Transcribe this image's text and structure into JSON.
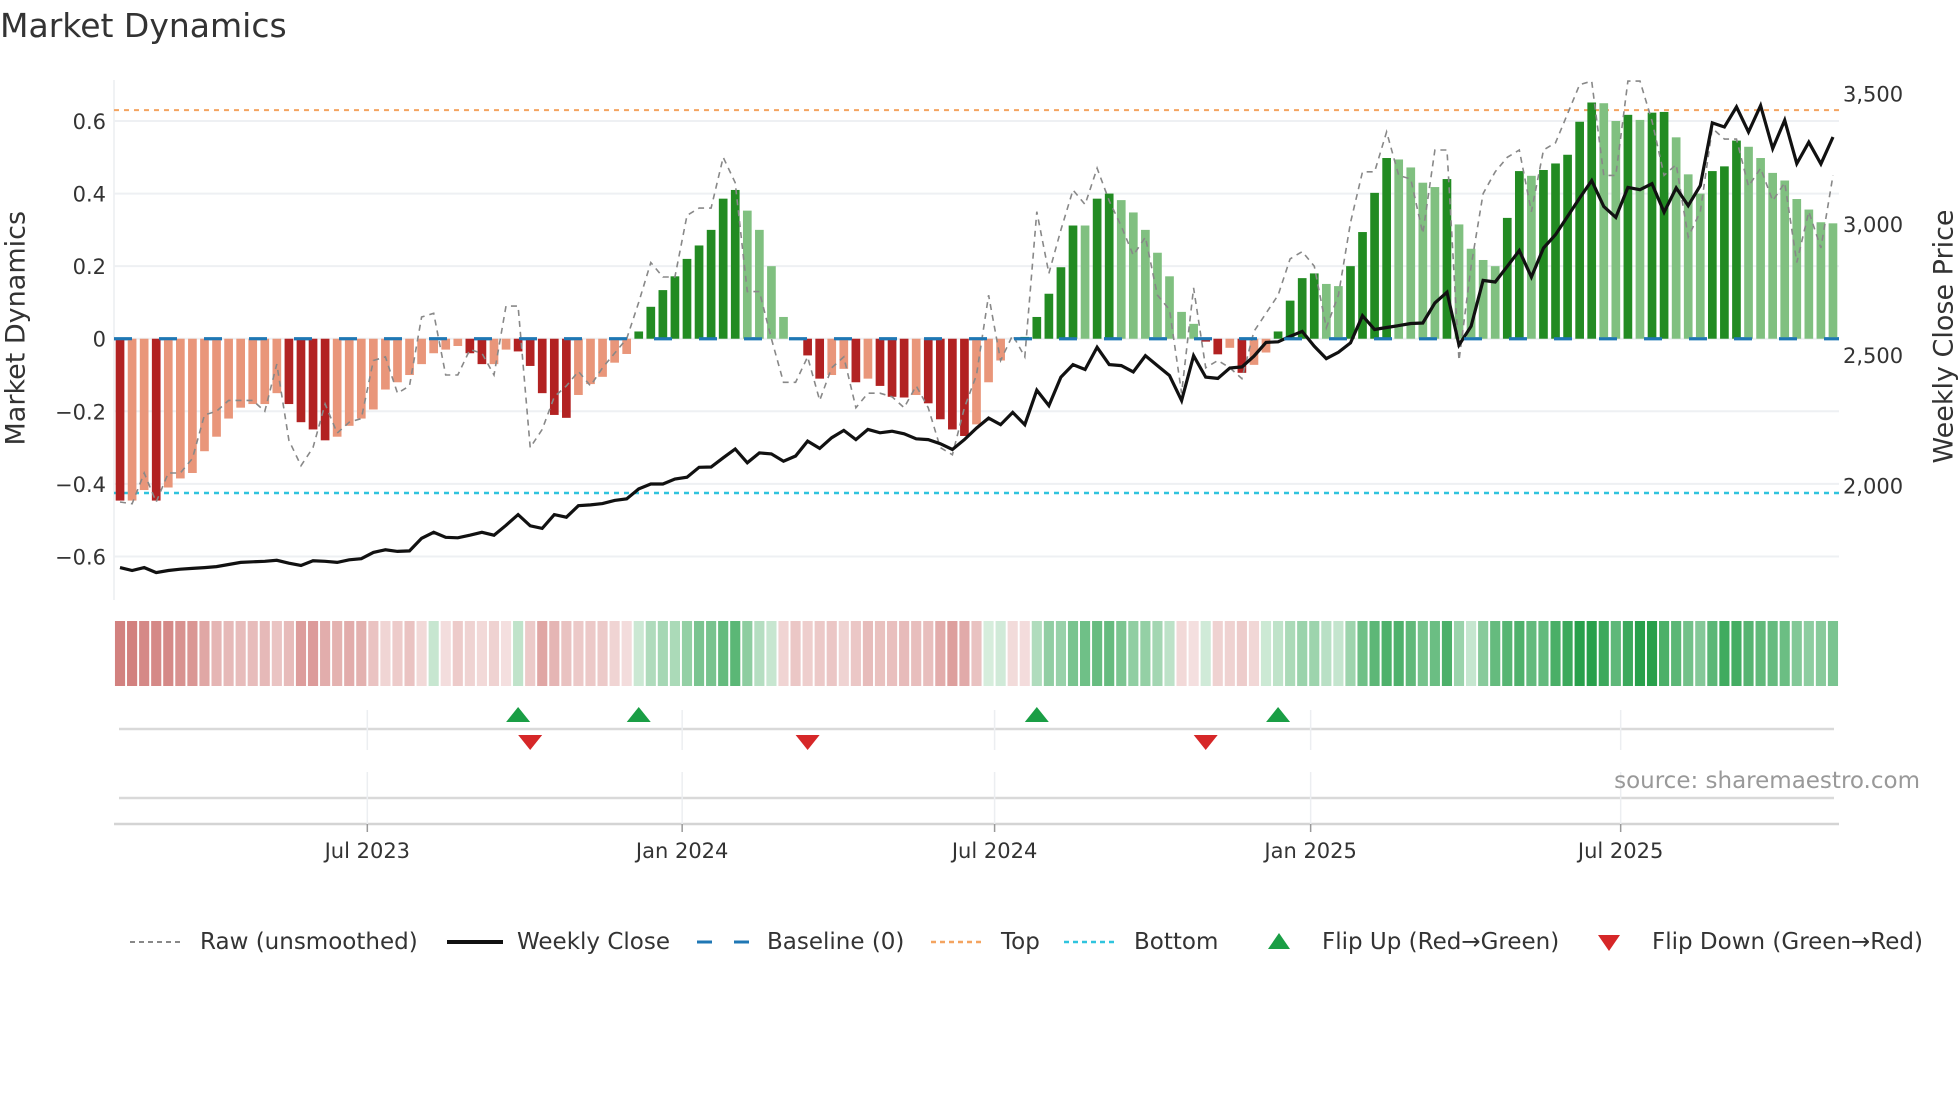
{
  "title": "Market Dynamics",
  "source": "source: sharemaestro.com",
  "legend": {
    "raw": "Raw (unsmoothed)",
    "close": "Weekly Close",
    "baseline": "Baseline (0)",
    "top": "Top",
    "bottom": "Bottom",
    "flip_up": "Flip Up (Red→Green)",
    "flip_down": "Flip Down (Green→Red)"
  },
  "colors": {
    "bar_dark_red": "#b22222",
    "bar_light_red": "#e9967a",
    "bar_dark_green": "#228b22",
    "bar_light_green": "#80c080",
    "raw": "#888888",
    "close": "#111111",
    "baseline": "#1f77b4",
    "top": "#f4a460",
    "bottom": "#2fc4de",
    "flip_up": "#1a9e45",
    "flip_down": "#d62728"
  },
  "chart_data": {
    "type": "bar",
    "title": "Market Dynamics",
    "xlabel": "",
    "ylabel": "Market Dynamics",
    "y2label": "Weekly Close Price",
    "xlim": [
      0.5,
      143.5
    ],
    "ylim": [
      -0.72,
      0.713
    ],
    "y2lim": [
      1562,
      3552
    ],
    "grid": true,
    "legend_position": "bottom",
    "yticks": [
      0.6,
      0.4,
      0.2,
      0,
      -0.2,
      -0.4,
      -0.6
    ],
    "ytick_labels": [
      "0.6",
      "0.4",
      "0.2",
      "0",
      "−0.2",
      "−0.4",
      "−0.6"
    ],
    "y2ticks": [
      3500,
      3000,
      2500,
      2000
    ],
    "y2tick_labels": [
      "3,500",
      "3,000",
      "2,500",
      "2,000"
    ],
    "xticks": [
      {
        "label": "Jul 2023",
        "week": 21.5
      },
      {
        "label": "Jan 2024",
        "week": 47.6
      },
      {
        "label": "Jul 2024",
        "week": 73.5
      },
      {
        "label": "Jan 2025",
        "week": 99.7
      },
      {
        "label": "Jul 2025",
        "week": 125.4
      }
    ],
    "top_level": 0.63,
    "bottom_level": -0.425,
    "baseline": 0,
    "momentum": [
      -0.446,
      -0.446,
      -0.417,
      -0.446,
      -0.41,
      -0.385,
      -0.37,
      -0.31,
      -0.27,
      -0.22,
      -0.19,
      -0.18,
      -0.18,
      -0.15,
      -0.18,
      -0.23,
      -0.25,
      -0.28,
      -0.27,
      -0.24,
      -0.22,
      -0.195,
      -0.14,
      -0.12,
      -0.1,
      -0.07,
      -0.04,
      -0.03,
      -0.02,
      -0.04,
      -0.07,
      -0.07,
      -0.03,
      -0.035,
      -0.075,
      -0.15,
      -0.21,
      -0.218,
      -0.155,
      -0.125,
      -0.105,
      -0.066,
      -0.042,
      0.02,
      0.088,
      0.134,
      0.172,
      0.22,
      0.257,
      0.3,
      0.386,
      0.41,
      0.353,
      0.3,
      0.2,
      0.06,
      0.0,
      -0.046,
      -0.11,
      -0.1,
      -0.083,
      -0.12,
      -0.11,
      -0.13,
      -0.16,
      -0.162,
      -0.155,
      -0.178,
      -0.222,
      -0.25,
      -0.268,
      -0.236,
      -0.12,
      -0.06,
      0.0,
      0.005,
      0.06,
      0.124,
      0.197,
      0.312,
      0.312,
      0.386,
      0.4,
      0.382,
      0.348,
      0.3,
      0.237,
      0.172,
      0.074,
      0.041,
      -0.008,
      -0.043,
      -0.025,
      -0.094,
      -0.072,
      -0.038,
      0.02,
      0.105,
      0.167,
      0.18,
      0.151,
      0.145,
      0.2,
      0.294,
      0.402,
      0.498,
      0.494,
      0.472,
      0.43,
      0.418,
      0.44,
      0.315,
      0.248,
      0.217,
      0.2,
      0.333,
      0.462,
      0.449,
      0.465,
      0.483,
      0.507,
      0.598,
      0.651,
      0.649,
      0.6,
      0.617,
      0.603,
      0.623,
      0.625,
      0.555,
      0.453,
      0.4,
      0.462,
      0.475,
      0.546,
      0.529,
      0.498,
      0.457,
      0.436,
      0.385,
      0.356,
      0.321,
      0.318
    ],
    "raw": [
      -0.45,
      -0.455,
      -0.37,
      -0.45,
      -0.37,
      -0.37,
      -0.33,
      -0.21,
      -0.2,
      -0.17,
      -0.17,
      -0.17,
      -0.2,
      -0.07,
      -0.28,
      -0.35,
      -0.3,
      -0.18,
      -0.26,
      -0.23,
      -0.22,
      -0.06,
      -0.05,
      -0.15,
      -0.13,
      0.06,
      0.07,
      -0.1,
      -0.1,
      -0.03,
      -0.04,
      -0.1,
      0.09,
      0.09,
      -0.3,
      -0.25,
      -0.16,
      -0.13,
      -0.09,
      -0.13,
      -0.08,
      -0.04,
      0.0,
      0.1,
      0.21,
      0.17,
      0.17,
      0.34,
      0.36,
      0.36,
      0.5,
      0.43,
      0.13,
      0.13,
      0.0,
      -0.12,
      -0.12,
      -0.05,
      -0.17,
      -0.08,
      -0.05,
      -0.19,
      -0.15,
      -0.15,
      -0.16,
      -0.19,
      -0.13,
      -0.19,
      -0.3,
      -0.32,
      -0.19,
      -0.1,
      0.12,
      -0.06,
      0.01,
      -0.05,
      0.35,
      0.18,
      0.3,
      0.41,
      0.37,
      0.47,
      0.38,
      0.31,
      0.23,
      0.28,
      0.12,
      0.08,
      -0.15,
      0.14,
      -0.08,
      -0.06,
      -0.08,
      -0.11,
      0.02,
      0.07,
      0.12,
      0.22,
      0.24,
      0.2,
      0.03,
      0.12,
      0.32,
      0.46,
      0.46,
      0.57,
      0.45,
      0.44,
      0.29,
      0.52,
      0.52,
      -0.06,
      0.2,
      0.4,
      0.46,
      0.5,
      0.52,
      0.35,
      0.52,
      0.54,
      0.62,
      0.7,
      0.71,
      0.45,
      0.45,
      0.71,
      0.71,
      0.6,
      0.45,
      0.48,
      0.28,
      0.35,
      0.58,
      0.55,
      0.55,
      0.42,
      0.47,
      0.38,
      0.43,
      0.21,
      0.35,
      0.25,
      0.45
    ],
    "close": [
      1686,
      1675,
      1686,
      1667,
      1675,
      1680,
      1683,
      1686,
      1690,
      1698,
      1706,
      1708,
      1710,
      1714,
      1703,
      1694,
      1712,
      1710,
      1706,
      1716,
      1720,
      1744,
      1754,
      1748,
      1750,
      1798,
      1821,
      1802,
      1800,
      1810,
      1821,
      1810,
      1848,
      1889,
      1846,
      1836,
      1889,
      1879,
      1923,
      1926,
      1931,
      1943,
      1949,
      1987,
      2006,
      2006,
      2025,
      2032,
      2070,
      2071,
      2106,
      2140,
      2087,
      2125,
      2121,
      2093,
      2113,
      2170,
      2142,
      2183,
      2211,
      2176,
      2215,
      2202,
      2208,
      2198,
      2179,
      2176,
      2160,
      2138,
      2176,
      2220,
      2258,
      2233,
      2280,
      2233,
      2365,
      2306,
      2415,
      2463,
      2444,
      2529,
      2463,
      2459,
      2435,
      2497,
      2459,
      2421,
      2325,
      2497,
      2415,
      2410,
      2450,
      2454,
      2495,
      2548,
      2550,
      2571,
      2590,
      2533,
      2486,
      2510,
      2546,
      2650,
      2597,
      2605,
      2612,
      2620,
      2622,
      2699,
      2740,
      2538,
      2610,
      2785,
      2779,
      2839,
      2899,
      2798,
      2909,
      2960,
      3030,
      3100,
      3167,
      3068,
      3026,
      3141,
      3132,
      3155,
      3046,
      3139,
      3071,
      3148,
      3388,
      3372,
      3449,
      3353,
      3454,
      3290,
      3398,
      3232,
      3314,
      3231,
      3334
    ],
    "flip_up_weeks": [
      34,
      44,
      77,
      97
    ],
    "flip_down_weeks": [
      35,
      58,
      91
    ]
  }
}
